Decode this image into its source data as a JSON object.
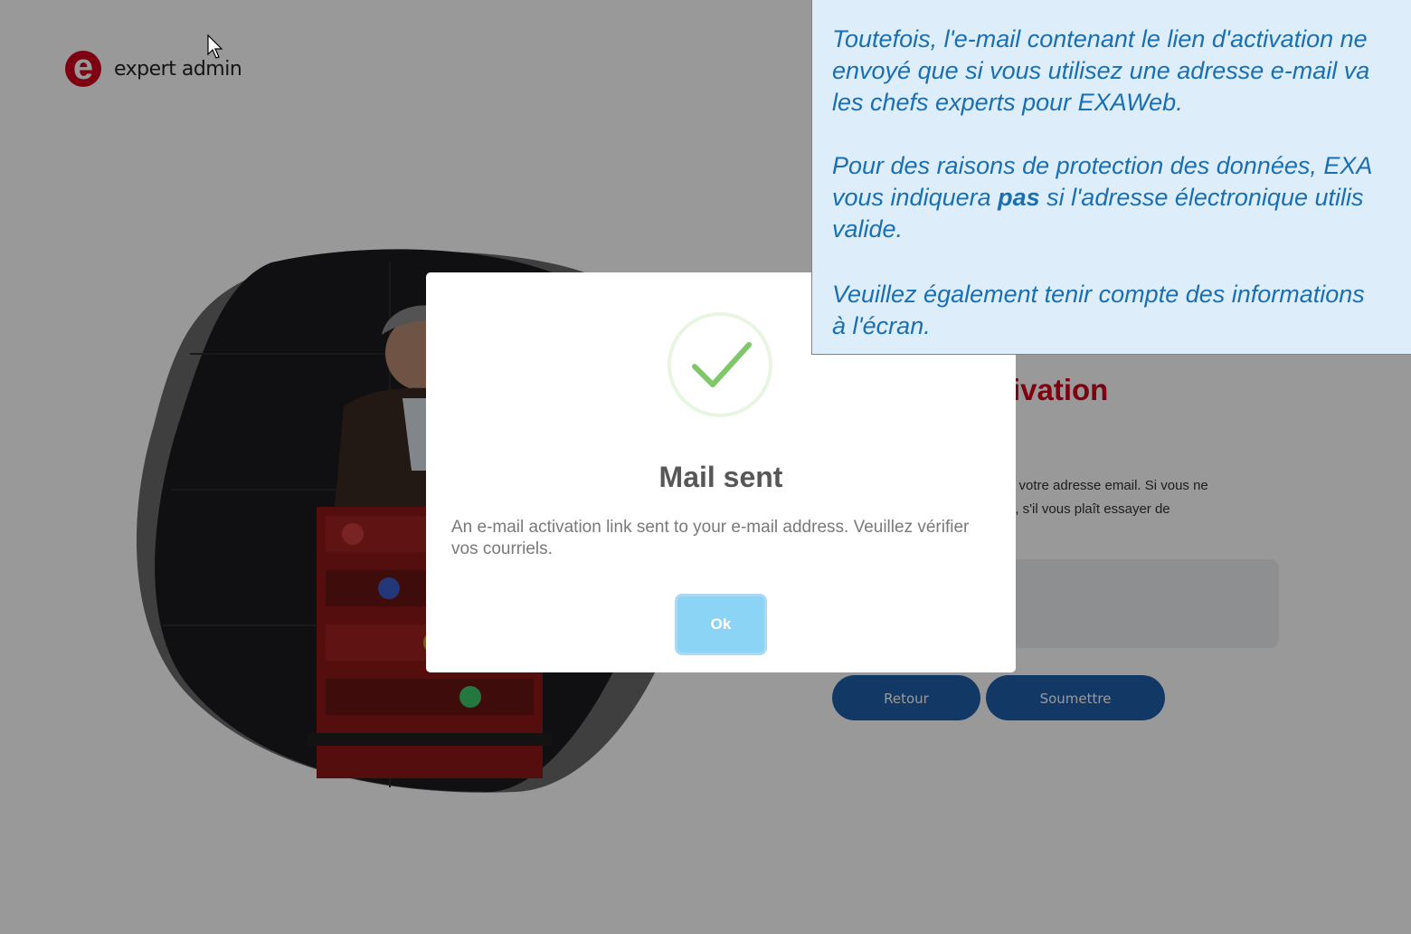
{
  "brand": {
    "logo_letter": "e",
    "logo_text_pre": "expert",
    "logo_text_post": " admin",
    "accent_color": "#d0021b"
  },
  "hero": {
    "title_fragment": "tivation",
    "description_line1": "tiver votre adresse email. Si vous ne",
    "description_line2": "utes, s'il vous plaît essayer de"
  },
  "form": {
    "email_placeholder": "",
    "back_label": "Retour",
    "submit_label": "Soumettre"
  },
  "dialog": {
    "icon": "check-icon",
    "title": "Mail sent",
    "message": "An e-mail activation link sent to your e-mail address. Veuillez vérifier vos courriels.",
    "ok_label": "Ok"
  },
  "tooltip": {
    "p1_line1": "Toutefois, l'e-mail contenant le lien d'activation ne",
    "p1_line2": "envoyé que si vous utilisez une adresse e-mail va",
    "p1_line3": "les chefs experts pour EXAWeb.",
    "p2_line1": "Pour des raisons de protection des données, EXA",
    "p2_line2_pre": "vous indiquera ",
    "p2_line2_bold": "pas",
    "p2_line2_post": " si l'adresse électronique utilis",
    "p2_line3": "valide.",
    "p3_line1": "Veuillez également tenir compte des informations",
    "p3_line2": "à l'écran."
  }
}
